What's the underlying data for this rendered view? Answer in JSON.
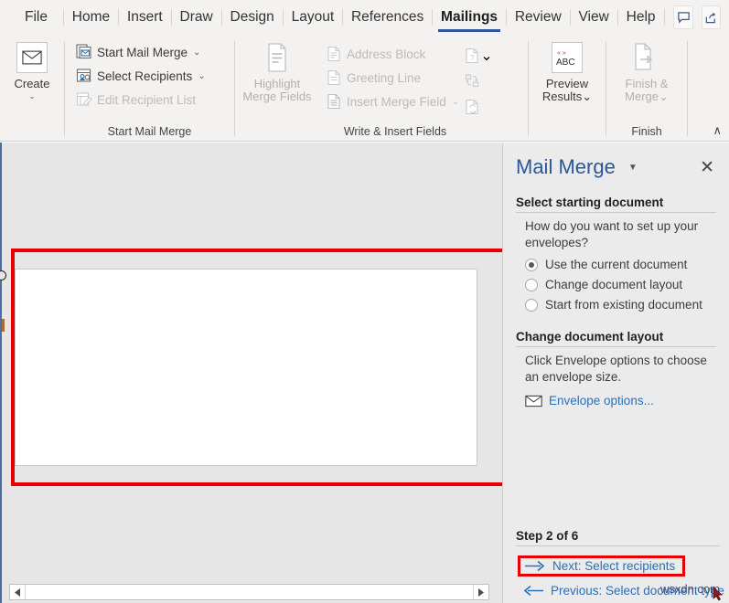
{
  "app": {
    "name": "Microsoft Word",
    "accent_color": "#2b579a",
    "highlight_color": "#e80000",
    "ribbon_bg": "#f3f2f1",
    "pane_bg": "#ebebeb",
    "doc_bg": "#e6e6e6"
  },
  "tabs": [
    {
      "label": "File",
      "active": false
    },
    {
      "label": "Home",
      "active": false
    },
    {
      "label": "Insert",
      "active": false
    },
    {
      "label": "Draw",
      "active": false
    },
    {
      "label": "Design",
      "active": false
    },
    {
      "label": "Layout",
      "active": false
    },
    {
      "label": "References",
      "active": false
    },
    {
      "label": "Mailings",
      "active": true
    },
    {
      "label": "Review",
      "active": false
    },
    {
      "label": "View",
      "active": false
    },
    {
      "label": "Help",
      "active": false
    }
  ],
  "titlebar_buttons": [
    {
      "name": "comments-icon",
      "label": "Comments"
    },
    {
      "name": "share-icon",
      "label": "Share"
    }
  ],
  "ribbon": {
    "collapse_caret": "∧",
    "groups": [
      {
        "label": "",
        "big_buttons": [
          {
            "label": "Create",
            "icon": "envelope-icon",
            "caret": "⌄",
            "disabled": false
          }
        ]
      },
      {
        "label": "Start Mail Merge",
        "items": [
          {
            "label": "Start Mail Merge",
            "icon": "start-mail-merge-icon",
            "caret": "⌄",
            "disabled": false
          },
          {
            "label": "Select Recipients",
            "icon": "select-recipients-icon",
            "caret": "⌄",
            "disabled": false
          },
          {
            "label": "Edit Recipient List",
            "icon": "edit-recipient-list-icon",
            "caret": "",
            "disabled": true
          }
        ]
      },
      {
        "label": "Write & Insert Fields",
        "big_buttons": [
          {
            "label_line1": "Highlight",
            "label_line2": "Merge Fields",
            "icon": "highlight-merge-fields-icon",
            "disabled": true
          }
        ],
        "items": [
          {
            "label": "Address Block",
            "icon": "address-block-icon",
            "caret": "",
            "disabled": true
          },
          {
            "label": "Greeting Line",
            "icon": "greeting-line-icon",
            "caret": "",
            "disabled": true
          },
          {
            "label": "Insert Merge Field",
            "icon": "insert-merge-field-icon",
            "caret": "⌄",
            "disabled": true
          }
        ],
        "icon_column": [
          {
            "name": "rules-icon",
            "caret": "⌄",
            "disabled": true
          },
          {
            "name": "match-fields-icon",
            "caret": "",
            "disabled": true
          },
          {
            "name": "update-labels-icon",
            "caret": "",
            "disabled": true
          }
        ]
      },
      {
        "label": "",
        "big_buttons": [
          {
            "label_line1": "Preview",
            "label_line2": "Results",
            "icon": "preview-results-abc-icon",
            "caret": "⌄",
            "disabled": false,
            "icon_text": "ABC"
          }
        ]
      },
      {
        "label": "Finish",
        "big_buttons": [
          {
            "label_line1": "Finish &",
            "label_line2": "Merge",
            "icon": "finish-and-merge-icon",
            "caret": "⌄",
            "disabled": true
          }
        ]
      }
    ]
  },
  "document": {
    "scrollbar": {
      "left_arrow": "◀",
      "right_arrow": "▶"
    }
  },
  "pane": {
    "title": "Mail Merge",
    "caret": "▼",
    "close": "✕",
    "section1": {
      "heading": "Select starting document",
      "question": "How do you want to set up your envelopes?",
      "options": [
        {
          "label": "Use the current document",
          "selected": true
        },
        {
          "label": "Change document layout",
          "selected": false
        },
        {
          "label": "Start from existing document",
          "selected": false
        }
      ]
    },
    "section2": {
      "heading": "Change document layout",
      "description": "Click Envelope options to choose an envelope size.",
      "link": {
        "label": "Envelope options...",
        "icon": "envelope-icon"
      }
    },
    "step": {
      "heading": "Step 2 of 6",
      "next": {
        "label": "Next: Select recipients",
        "icon": "arrow-right-icon",
        "highlighted": true
      },
      "previous": {
        "label": "Previous: Select document type",
        "icon": "arrow-left-icon",
        "highlighted": false
      }
    }
  },
  "watermark": {
    "text": "wsxdn.com"
  }
}
